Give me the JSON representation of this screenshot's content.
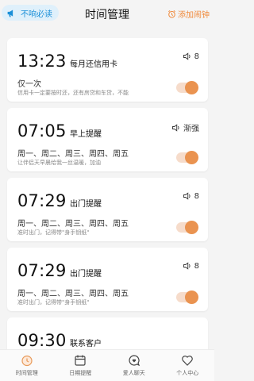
{
  "header": {
    "mute_label": "不响必读",
    "title": "时间管理",
    "add_alarm_label": "添加闹钟",
    "accent_color": "#f08a3c",
    "mute_color": "#1a8fd8"
  },
  "alarms": [
    {
      "time": "13:23",
      "title": "每月还信用卡",
      "sound": "8",
      "repeat": "仅一次",
      "note": "信用卡一定要按时还，还有房贷和车贷，不能",
      "enabled": true
    },
    {
      "time": "07:05",
      "title": "早上提醒",
      "sound": "渐强",
      "repeat": "周一、周二、周三、周四、周五",
      "note": "让伴侣天早晨给我一丝温暖，加油",
      "enabled": true
    },
    {
      "time": "07:29",
      "title": "出门提醒",
      "sound": "8",
      "repeat": "周一、周二、周三、周四、周五",
      "note": "准时出门，记得带\"身手钥纸\"",
      "enabled": true
    },
    {
      "time": "07:29",
      "title": "出门提醒",
      "sound": "8",
      "repeat": "周一、周二、周三、周四、周五",
      "note": "准时出门，记得带\"身手钥纸\"",
      "enabled": true
    },
    {
      "time": "09:30",
      "title": "联系客户",
      "sound": "",
      "repeat": "",
      "note": "",
      "enabled": true
    }
  ],
  "tabs": [
    {
      "label": "时间管理",
      "icon": "alarm-clock-icon",
      "active": true
    },
    {
      "label": "日期提醒",
      "icon": "calendar-icon",
      "active": false
    },
    {
      "label": "爱人聊天",
      "icon": "chat-heart-icon",
      "active": false
    },
    {
      "label": "个人中心",
      "icon": "heart-icon",
      "active": false
    }
  ],
  "toggle_color": "#ea9350"
}
